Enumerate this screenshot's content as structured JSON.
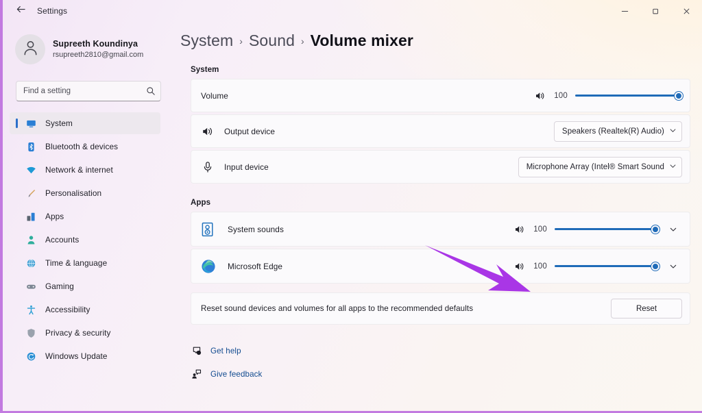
{
  "window": {
    "app_title": "Settings",
    "back_icon": "back-arrow-icon",
    "minimize_label": "–",
    "maximize_label": "❐",
    "close_label": "✕",
    "frame_color": "#c27ae0"
  },
  "sidebar": {
    "account": {
      "name": "Supreeth Koundinya",
      "email": "rsupreeth2810@gmail.com",
      "avatar_icon": "person-avatar-icon"
    },
    "search": {
      "placeholder": "Find a setting",
      "value": "",
      "icon": "search-icon"
    },
    "items": [
      {
        "label": "System",
        "icon": "monitor-icon",
        "selected": true
      },
      {
        "label": "Bluetooth & devices",
        "icon": "bluetooth-icon",
        "selected": false
      },
      {
        "label": "Network & internet",
        "icon": "wifi-icon",
        "selected": false
      },
      {
        "label": "Personalisation",
        "icon": "paintbrush-icon",
        "selected": false
      },
      {
        "label": "Apps",
        "icon": "apps-grid-icon",
        "selected": false
      },
      {
        "label": "Accounts",
        "icon": "accounts-icon",
        "selected": false
      },
      {
        "label": "Time & language",
        "icon": "globe-clock-icon",
        "selected": false
      },
      {
        "label": "Gaming",
        "icon": "gamepad-icon",
        "selected": false
      },
      {
        "label": "Accessibility",
        "icon": "accessibility-icon",
        "selected": false
      },
      {
        "label": "Privacy & security",
        "icon": "shield-icon",
        "selected": false
      },
      {
        "label": "Windows Update",
        "icon": "update-icon",
        "selected": false
      }
    ],
    "selection_indicator_color": "#2a6fc9"
  },
  "breadcrumb": {
    "items": [
      {
        "label": "System",
        "current": false
      },
      {
        "label": "Sound",
        "current": false
      },
      {
        "label": "Volume mixer",
        "current": true
      }
    ],
    "separator": "›"
  },
  "system_section": {
    "label": "System",
    "volume_row": {
      "label": "Volume",
      "speaker_icon": "speaker-waves-icon",
      "value": "100",
      "slider_percent": 100,
      "accent_color": "#1f6bb8"
    },
    "output_row": {
      "label": "Output device",
      "icon": "speaker-waves-icon",
      "dropdown_value": "Speakers (Realtek(R) Audio)",
      "chevron_icon": "chevron-down-icon"
    },
    "input_row": {
      "label": "Input device",
      "icon": "microphone-icon",
      "dropdown_value": "Microphone Array (Intel® Smart Sound",
      "chevron_icon": "chevron-down-icon"
    }
  },
  "apps_section": {
    "label": "Apps",
    "rows": [
      {
        "name": "System sounds",
        "app_icon": "system-sounds-icon",
        "speaker_icon": "speaker-waves-icon",
        "value": "100",
        "slider_percent": 100,
        "chevron_icon": "chevron-down-icon"
      },
      {
        "name": "Microsoft Edge",
        "app_icon": "microsoft-edge-icon",
        "speaker_icon": "speaker-waves-icon",
        "value": "100",
        "slider_percent": 100,
        "chevron_icon": "chevron-down-icon"
      }
    ]
  },
  "reset_section": {
    "text": "Reset sound devices and volumes for all apps to the recommended defaults",
    "button_label": "Reset"
  },
  "footer": {
    "links": [
      {
        "label": "Get help",
        "icon": "help-question-icon"
      },
      {
        "label": "Give feedback",
        "icon": "feedback-icon"
      }
    ],
    "link_color": "#114b8f"
  },
  "annotation": {
    "type": "arrow",
    "color": "#a936e6",
    "points_to": "microsoft-edge-volume-icon"
  }
}
